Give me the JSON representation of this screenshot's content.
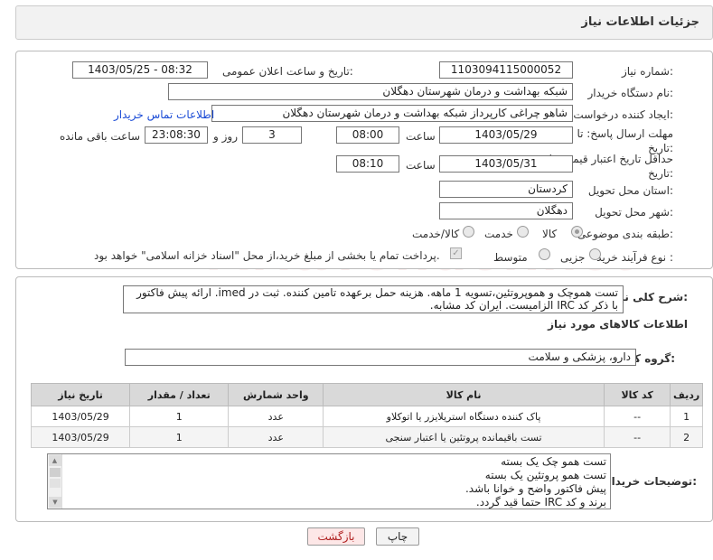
{
  "header": {
    "title": "جزئیات اطلاعات نیاز"
  },
  "fields": {
    "need_number_label": "شماره نیاز:",
    "need_number": "1103094115000052",
    "announce_label": "تاریخ و ساعت اعلان عمومی:",
    "announce_value": "1403/05/25 - 08:32",
    "buyer_org_label": "نام دستگاه خریدار:",
    "buyer_org": "شبکه بهداشت و درمان شهرستان دهگلان",
    "creator_label": "ایجاد کننده درخواست:",
    "creator": "شاهو چراغی کارپرداز شبکه بهداشت و درمان شهرستان دهگلان",
    "contact_link": "اطلاعات تماس خریدار",
    "deadline_label": "مهلت ارسال پاسخ: تا تاریخ:",
    "deadline_date": "1403/05/29",
    "time_label": "ساعت",
    "deadline_time": "08:00",
    "days_value": "3",
    "days_label": "روز و",
    "remaining_time": "23:08:30",
    "remaining_label": "ساعت باقی مانده",
    "price_validity_label": "حداقل تاریخ اعتبار قیمت: تا تاریخ:",
    "price_validity_date": "1403/05/31",
    "price_validity_time": "08:10",
    "province_label": "استان محل تحویل:",
    "province": "کردستان",
    "city_label": "شهر محل تحویل:",
    "city": "دهگلان",
    "category_label": "طبقه بندی موضوعی:",
    "category_options": [
      "کالا",
      "خدمت",
      "کالا/خدمت"
    ],
    "process_label": "نوع فرآیند خرید :",
    "process_options": [
      "جزیی",
      "متوسط"
    ],
    "payment_note": "پرداخت تمام یا بخشی از مبلغ خرید،از محل \"اسناد خزانه اسلامی\" خواهد بود."
  },
  "summary": {
    "label": "شرح کلی نیاز:",
    "text": "تست هموچک و هموپروتئین،تسویه 1 ماهه. هزینه حمل برعهده تامین کننده. ثبت در imed. ارائه پیش فاکتور با ذکر کد IRC الزامیست. ایران کد مشابه."
  },
  "goods": {
    "section_title": "اطلاعات کالاهای مورد نیاز",
    "group_label": "گروه کالا:",
    "group_value": "دارو، پزشکی و سلامت",
    "columns": [
      "ردیف",
      "کد کالا",
      "نام کالا",
      "واحد شمارش",
      "تعداد / مقدار",
      "تاریخ نیاز"
    ],
    "rows": [
      [
        "1",
        "--",
        "پاک کننده دستگاه استریلایزر یا اتوکلاو",
        "عدد",
        "1",
        "1403/05/29"
      ],
      [
        "2",
        "--",
        "تست باقیمانده پروتئین یا اعتبار سنجی",
        "عدد",
        "1",
        "1403/05/29"
      ]
    ]
  },
  "buyer_notes": {
    "label": "توضیحات خریدار:",
    "lines": [
      "تست همو چک یک بسته",
      "تست همو پروتئین یک بسته",
      "پیش فاکتور واضح و خوانا باشد.",
      "برند و کد IRC حتما قید گردد."
    ]
  },
  "buttons": {
    "print": "چاپ",
    "back": "بازگشت"
  },
  "watermark": "AriaTender.net"
}
